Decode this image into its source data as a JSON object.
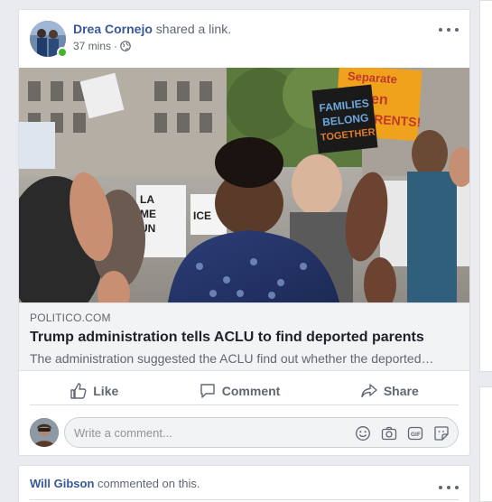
{
  "post": {
    "author": "Drea Cornejo",
    "action": " shared a link.",
    "timestamp": "37 mins",
    "separator": "·",
    "privacy_icon": "globe-icon",
    "link": {
      "domain": "POLITICO.COM",
      "title": "Trump administration tells ACLU to find deported parents",
      "description": "The administration suggested the ACLU find out whether the deported…",
      "image_signs": [
        "Separate",
        "Aren",
        "PARENTS!",
        "FAMILIES",
        "BELONG",
        "TOGETHER",
        "LA",
        "ME",
        "UN",
        "ICE"
      ]
    },
    "actions": {
      "like": "Like",
      "comment": "Comment",
      "share": "Share"
    },
    "comment_placeholder": "Write a comment...",
    "comment_icons": [
      "emoji-icon",
      "camera-icon",
      "gif-icon",
      "sticker-icon"
    ],
    "colors": {
      "name_link": "#365899",
      "secondary_text": "#606770",
      "online": "#42b72a",
      "background": "#e9ebee"
    }
  },
  "next_post": {
    "author": "Will Gibson",
    "action": " commented on this."
  }
}
